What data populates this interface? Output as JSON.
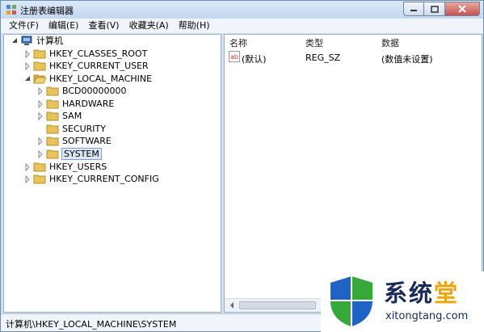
{
  "window": {
    "title": "注册表编辑器",
    "controls": {
      "minimize": "minimize",
      "maximize": "maximize",
      "close": "close"
    }
  },
  "menu": [
    "文件(F)",
    "编辑(E)",
    "查看(V)",
    "收藏夹(A)",
    "帮助(H)"
  ],
  "tree": {
    "root": "计算机",
    "items": [
      {
        "label": "HKEY_CLASSES_ROOT"
      },
      {
        "label": "HKEY_CURRENT_USER"
      },
      {
        "label": "HKEY_LOCAL_MACHINE"
      },
      {
        "label": "BCD00000000"
      },
      {
        "label": "HARDWARE"
      },
      {
        "label": "SAM"
      },
      {
        "label": "SECURITY"
      },
      {
        "label": "SOFTWARE"
      },
      {
        "label": "SYSTEM"
      },
      {
        "label": "HKEY_USERS"
      },
      {
        "label": "HKEY_CURRENT_CONFIG"
      }
    ]
  },
  "list": {
    "columns": [
      "名称",
      "类型",
      "数据"
    ],
    "rows": [
      {
        "name": "(默认)",
        "type": "REG_SZ",
        "data": "(数值未设置)"
      }
    ]
  },
  "status": {
    "path": "计算机\\HKEY_LOCAL_MACHINE\\SYSTEM"
  },
  "watermark": {
    "brand_a": "系统",
    "brand_b": "堂",
    "url": "xitongtang.com"
  },
  "colors": {
    "selection_bg": "#dbe7f7",
    "selection_border": "#7da2ce",
    "folder": "#e8c25a",
    "shield_blue": "#1f63c7",
    "shield_green": "#37a83a",
    "brand_accent": "#f0a400"
  }
}
